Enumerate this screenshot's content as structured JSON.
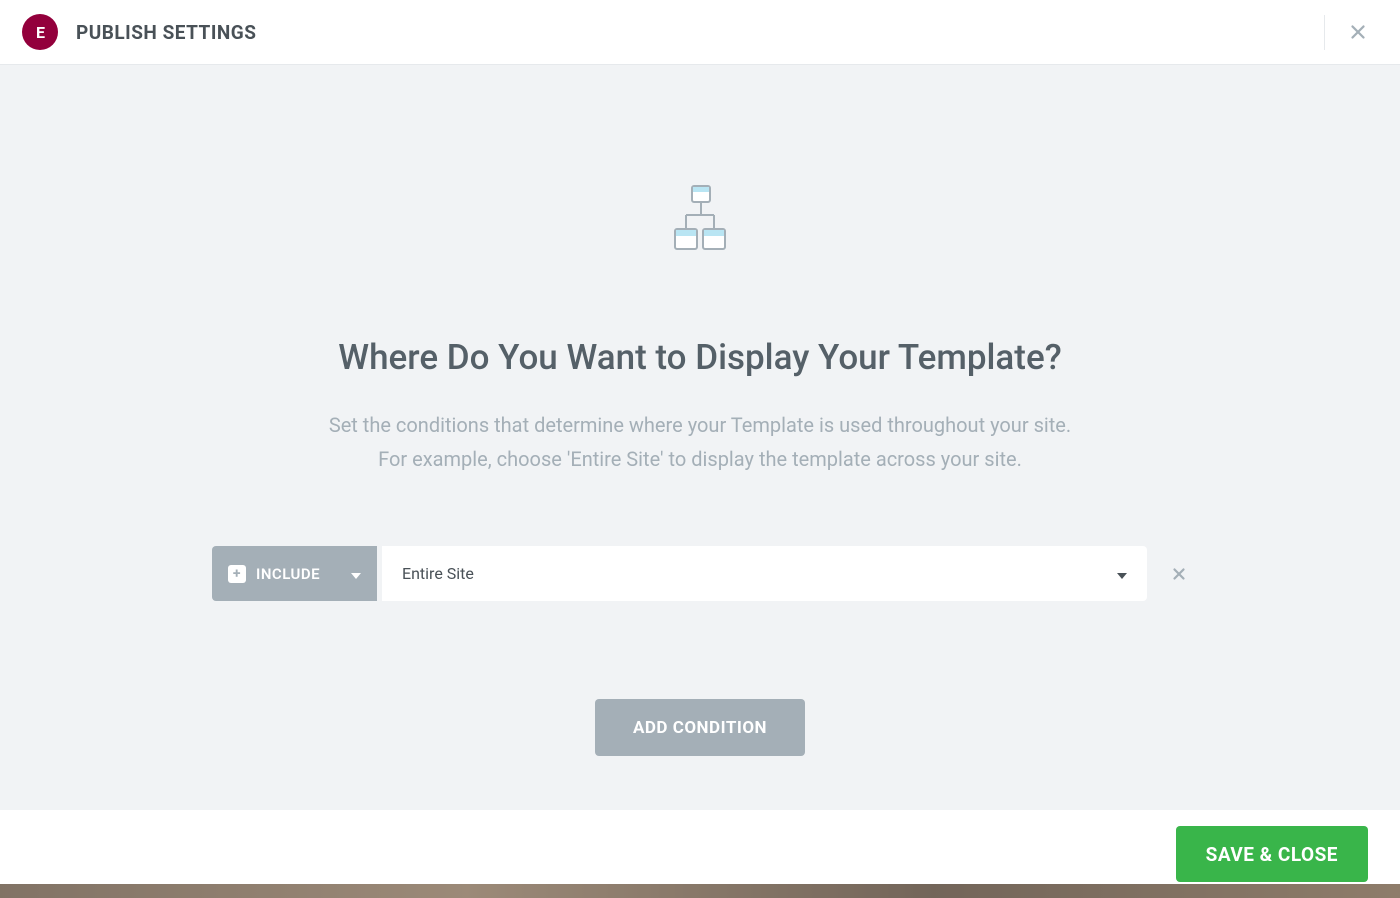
{
  "header": {
    "logo_text": "E",
    "title": "PUBLISH SETTINGS"
  },
  "main": {
    "heading": "Where Do You Want to Display Your Template?",
    "description_line1": "Set the conditions that determine where your Template is used throughout your site.",
    "description_line2": "For example, choose 'Entire Site' to display the template across your site."
  },
  "condition": {
    "include_label": "INCLUDE",
    "location_value": "Entire Site"
  },
  "buttons": {
    "add_condition": "ADD CONDITION",
    "save_close": "SAVE & CLOSE"
  }
}
